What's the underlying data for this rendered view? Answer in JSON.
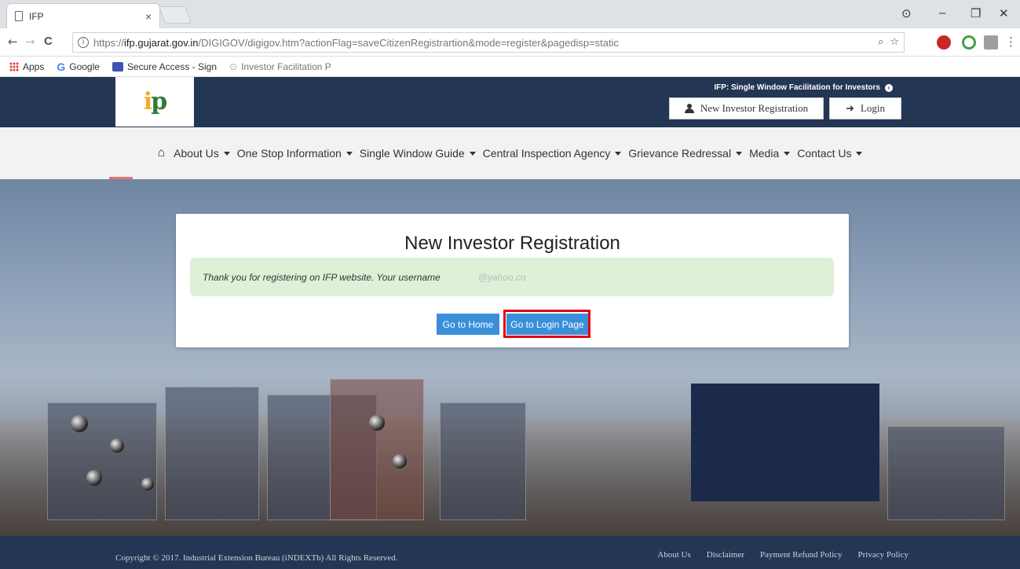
{
  "browser": {
    "tab_title": "IFP",
    "tab_close": "×",
    "url_prefix": "https://",
    "url_domain": "ifp.gujarat.gov.in",
    "url_path": "/DIGIGOV/digigov.htm?actionFlag=saveCitizenRegistrartion&mode=register&pagedisp=static",
    "window_controls": {
      "profile": "⊙",
      "minimize": "–",
      "restore": "❐",
      "close": "✕"
    },
    "nav": {
      "back": "←",
      "forward": "→",
      "reload": "C"
    },
    "omni_icons": {
      "zoom": "⌕",
      "star": "☆"
    },
    "bookmarks": {
      "apps": "Apps",
      "google": "Google",
      "google_letter": "G",
      "secure_access": "Secure Access - Sign",
      "investor": "Investor Facilitation P"
    }
  },
  "header": {
    "logo": {
      "letter_i": "i",
      "letter_p": "p"
    },
    "title": "IFP: Single Window Facilitation for Investors",
    "register_button": "New Investor Registration",
    "login_button": "Login",
    "login_icon": "➜"
  },
  "nav": {
    "home_icon": "⌂",
    "items": [
      {
        "label": "About Us"
      },
      {
        "label": "One Stop Information"
      },
      {
        "label": "Single Window Guide"
      },
      {
        "label": "Central Inspection Agency"
      },
      {
        "label": "Grievance Redressal"
      },
      {
        "label": "Media"
      },
      {
        "label": "Contact Us"
      }
    ]
  },
  "card": {
    "title": "New Investor Registration",
    "message": "Thank you for registering on IFP website. Your username",
    "masked_username": "@yahoo.co",
    "home_button": "Go to Home",
    "login_page_button": "Go to Login Page"
  },
  "footer": {
    "copyright": "Copyright © 2017. Industrial Extension Bureau (iNDEXTb) All Rights Reserved.",
    "links": [
      "About Us",
      "Disclaimer",
      "Payment Refund Policy",
      "Privacy Policy"
    ]
  },
  "colors": {
    "header_bg": "#233653",
    "button_blue": "#3a8fd9",
    "alert_green": "#dff0d8",
    "highlight_red": "#e3000f"
  }
}
